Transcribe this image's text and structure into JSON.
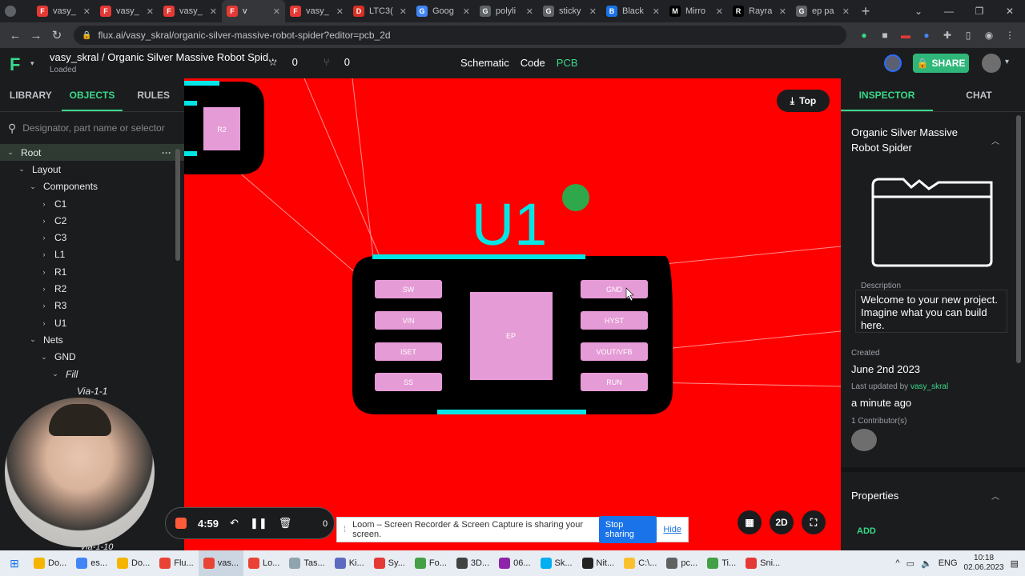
{
  "browser": {
    "tabs": [
      {
        "label": "vasy_",
        "color": "#e53935",
        "glyph": "F"
      },
      {
        "label": "vasy_",
        "color": "#e53935",
        "glyph": "F"
      },
      {
        "label": "vasy_",
        "color": "#e53935",
        "glyph": "F"
      },
      {
        "label": "v",
        "color": "#e53935",
        "glyph": "F",
        "active": true
      },
      {
        "label": "vasy_",
        "color": "#e53935",
        "glyph": "F"
      },
      {
        "label": "LTC3(",
        "color": "#d93025",
        "glyph": "D"
      },
      {
        "label": "Goog",
        "color": "#4285f4",
        "glyph": "G"
      },
      {
        "label": "polyli",
        "color": "#5f6368",
        "glyph": "G"
      },
      {
        "label": "sticky",
        "color": "#5f6368",
        "glyph": "G"
      },
      {
        "label": "Black",
        "color": "#1a73e8",
        "glyph": "B"
      },
      {
        "label": "Mirro",
        "color": "#000000",
        "glyph": "M"
      },
      {
        "label": "Rayra",
        "color": "#000000",
        "glyph": "R"
      },
      {
        "label": "ep pa",
        "color": "#5f6368",
        "glyph": "G"
      }
    ],
    "new_tab": "+",
    "url": "flux.ai/vasy_skral/organic-silver-massive-robot-spider?editor=pcb_2d"
  },
  "header": {
    "logo": "F",
    "project_title": "vasy_skral / Organic Silver Massive Robot Spid...",
    "status": "Loaded",
    "stars": "0",
    "forks": "0",
    "modes": [
      "Schematic",
      "Code",
      "PCB"
    ],
    "active_mode": "PCB",
    "share_label": "SHARE"
  },
  "left_panel": {
    "tabs": [
      "LIBRARY",
      "OBJECTS",
      "RULES"
    ],
    "active_tab": "OBJECTS",
    "search_placeholder": "Designator, part name or selector",
    "tree": [
      {
        "label": "Root",
        "level": 0,
        "caret": "v",
        "selected": true
      },
      {
        "label": "Layout",
        "level": 1,
        "caret": "v"
      },
      {
        "label": "Components",
        "level": 2,
        "caret": "v"
      },
      {
        "label": "C1",
        "level": 3,
        "caret": ">"
      },
      {
        "label": "C2",
        "level": 3,
        "caret": ">"
      },
      {
        "label": "C3",
        "level": 3,
        "caret": ">"
      },
      {
        "label": "L1",
        "level": 3,
        "caret": ">"
      },
      {
        "label": "R1",
        "level": 3,
        "caret": ">"
      },
      {
        "label": "R2",
        "level": 3,
        "caret": ">"
      },
      {
        "label": "R3",
        "level": 3,
        "caret": ">"
      },
      {
        "label": "U1",
        "level": 3,
        "caret": ">"
      },
      {
        "label": "Nets",
        "level": 2,
        "caret": "v"
      },
      {
        "label": "GND",
        "level": 3,
        "caret": "v"
      },
      {
        "label": "Fill",
        "level": 4,
        "caret": "v",
        "italic": true
      },
      {
        "label": "Via-1-1",
        "level": 5,
        "caret": "",
        "italic": true
      }
    ],
    "bottom_via": "Via-1-10"
  },
  "canvas": {
    "view_button": "Top",
    "designator": "U1",
    "partial_label": "R2",
    "pads_left": [
      "SW",
      "VIN",
      "ISET",
      "SS"
    ],
    "pads_right": [
      "GND",
      "HYST",
      "VOUT/VFB",
      "RUN"
    ],
    "center_pad": "EP",
    "controls": {
      "grid": "grid-icon",
      "mode": "2D",
      "fullscreen": "fullscreen-icon"
    }
  },
  "loom": {
    "timer": "4:59",
    "count": "0",
    "banner_text": "Loom – Screen Recorder & Screen Capture is sharing your screen.",
    "stop_label": "Stop sharing",
    "hide_label": "Hide"
  },
  "inspector": {
    "tabs": [
      "INSPECTOR",
      "CHAT"
    ],
    "active_tab": "INSPECTOR",
    "title": "Organic Silver Massive Robot Spider",
    "description_label": "Description",
    "description": "Welcome to your new project. Imagine what you can build here.",
    "created_label": "Created",
    "created": "June 2nd 2023",
    "updated_label": "Last updated by",
    "updated_user": "vasy_skral",
    "updated": "a minute ago",
    "contributors": "1 Contributor(s)",
    "properties_label": "Properties",
    "add_label": "ADD"
  },
  "taskbar": {
    "items": [
      {
        "label": "Do...",
        "color": "#f4b400"
      },
      {
        "label": "es...",
        "color": "#4285f4"
      },
      {
        "label": "Do...",
        "color": "#f4b400"
      },
      {
        "label": "Flu...",
        "color": "#ea4335"
      },
      {
        "label": "vas...",
        "color": "#ea4335",
        "active": true
      },
      {
        "label": "Lo...",
        "color": "#ea4335"
      },
      {
        "label": "Tas...",
        "color": "#90a4ae"
      },
      {
        "label": "Ki...",
        "color": "#5c6bc0"
      },
      {
        "label": "Sy...",
        "color": "#e53935"
      },
      {
        "label": "Fo...",
        "color": "#43a047"
      },
      {
        "label": "3D...",
        "color": "#424242"
      },
      {
        "label": "06...",
        "color": "#8e24aa"
      },
      {
        "label": "Sk...",
        "color": "#00aff0"
      },
      {
        "label": "Nit...",
        "color": "#212121"
      },
      {
        "label": "C:\\...",
        "color": "#fbc02d"
      },
      {
        "label": "pc...",
        "color": "#616161"
      },
      {
        "label": "Ti...",
        "color": "#43a047"
      },
      {
        "label": "Sni...",
        "color": "#e53935"
      }
    ],
    "lang": "ENG",
    "time": "10:18",
    "date": "02.06.2023"
  }
}
